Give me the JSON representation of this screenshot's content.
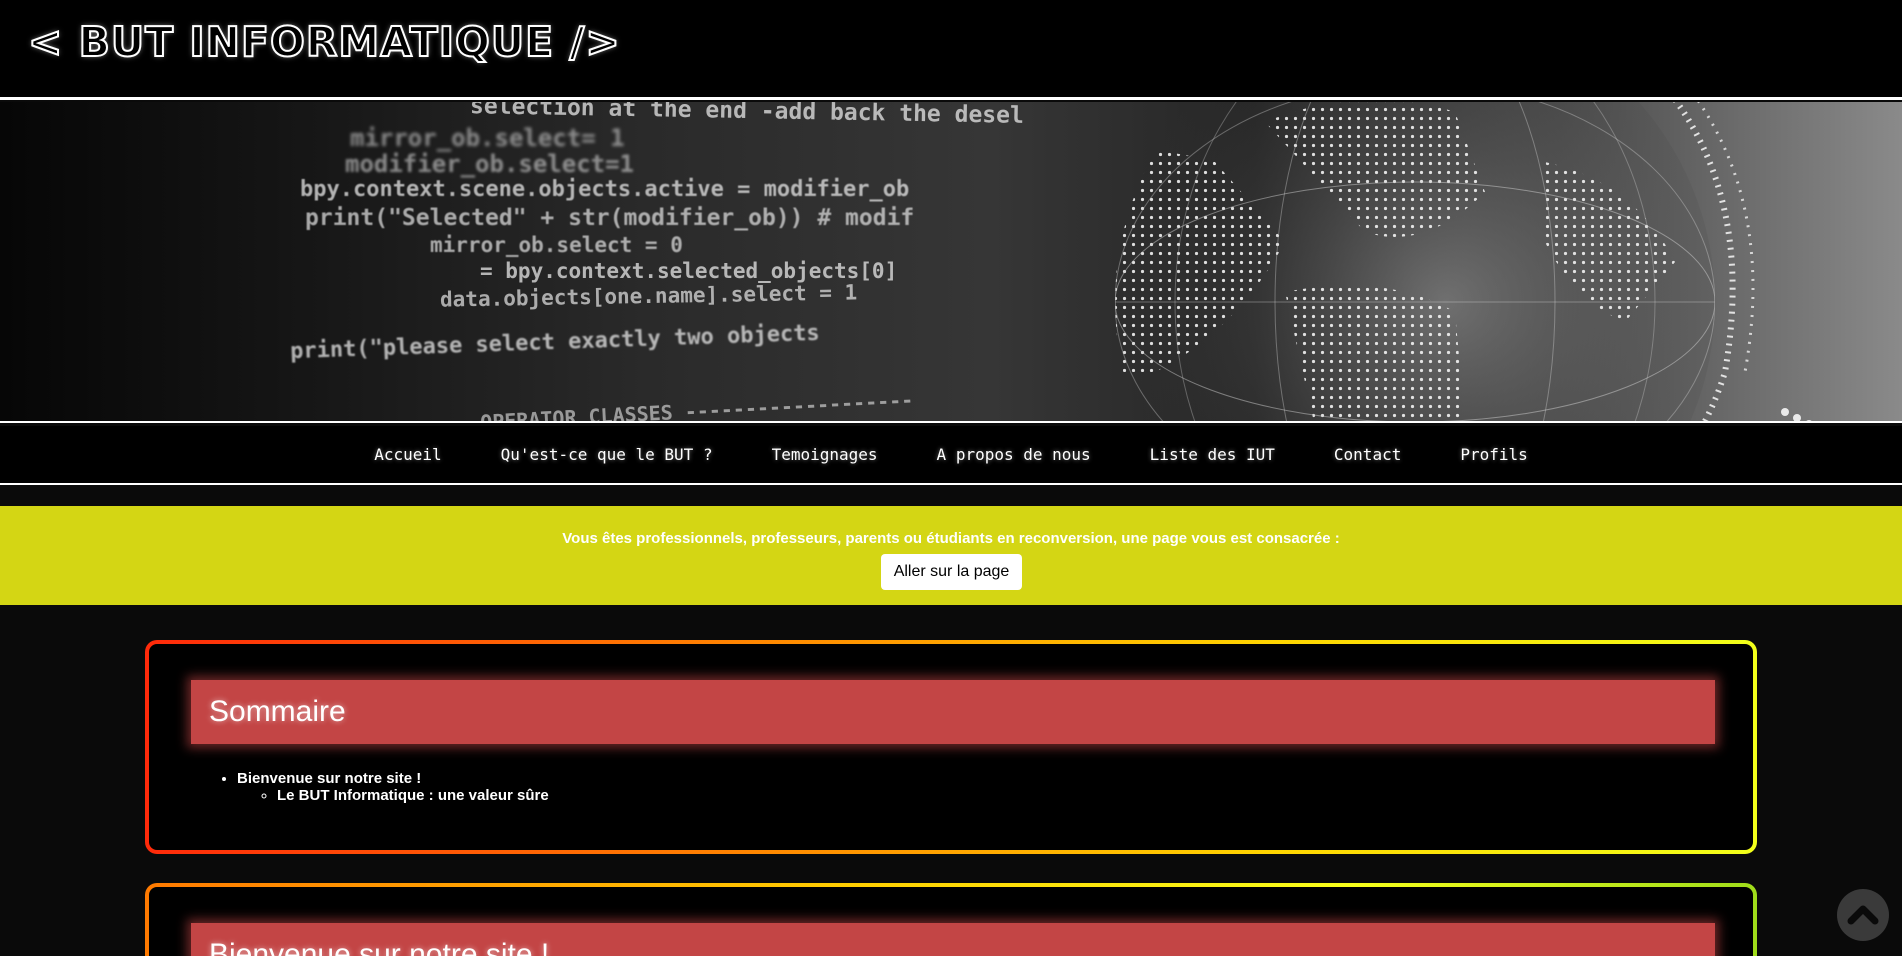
{
  "header": {
    "logo": "< BUT INFORMATIQUE />"
  },
  "banner": {
    "code_lines": [
      "selection at the end -add back the desel",
      "mirror_ob.select= 1",
      "modifier_ob.select=1",
      "bpy.context.scene.objects.active = modifier_ob",
      "print(\"Selected\" + str(modifier_ob)) # modif",
      "mirror_ob.select = 0",
      "= bpy.context.selected_objects[0]",
      "data.objects[one.name].select = 1",
      "print(\"please select exactly two objects",
      "OPERATOR CLASSES -------------------"
    ]
  },
  "nav": {
    "items": [
      "Accueil",
      "Qu'est-ce que le BUT ?",
      "Temoignages",
      "A propos de nous",
      "Liste des IUT",
      "Contact",
      "Profils"
    ]
  },
  "promo": {
    "text": "Vous êtes professionnels, professeurs, parents ou étudiants en reconversion, une page vous est consacrée :",
    "button": "Aller sur la page",
    "color": "#d4d614"
  },
  "sommaire": {
    "title": "Sommaire",
    "items": [
      {
        "label": "Bienvenue sur notre site !",
        "children": [
          "Le BUT Informatique : une valeur sûre"
        ]
      }
    ]
  },
  "section2": {
    "title": "Bienvenue sur notre site !"
  },
  "scroll_top": {
    "icon": "chevron-up-icon"
  },
  "colors": {
    "title_band": "#c34545",
    "page_bg": "#0a0a0a"
  }
}
